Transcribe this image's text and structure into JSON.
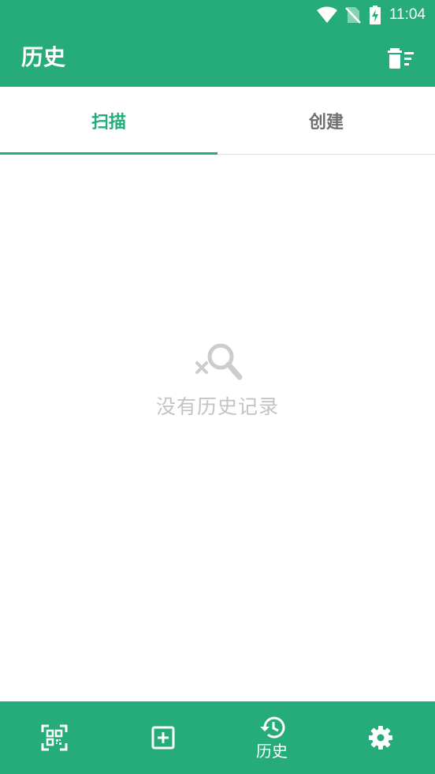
{
  "status_bar": {
    "time": "11:04",
    "icons": [
      "wifi-icon",
      "no-sim-icon",
      "battery-charging-icon"
    ]
  },
  "app_bar": {
    "title": "历史",
    "action_icon": "clear-history-icon"
  },
  "tabs": [
    {
      "label": "扫描",
      "active": true
    },
    {
      "label": "创建",
      "active": false
    }
  ],
  "empty_state": {
    "icon": "search-not-found-icon",
    "message": "没有历史记录"
  },
  "bottom_nav": [
    {
      "icon": "qr-scan-icon",
      "label": "",
      "active": false
    },
    {
      "icon": "add-box-icon",
      "label": "",
      "active": false
    },
    {
      "icon": "history-icon",
      "label": "历史",
      "active": true
    },
    {
      "icon": "settings-gear-icon",
      "label": "",
      "active": false
    }
  ],
  "colors": {
    "primary": "#26ab7b",
    "inactive_tab": "#6f6f6f",
    "empty_text": "#c3c3c3"
  }
}
